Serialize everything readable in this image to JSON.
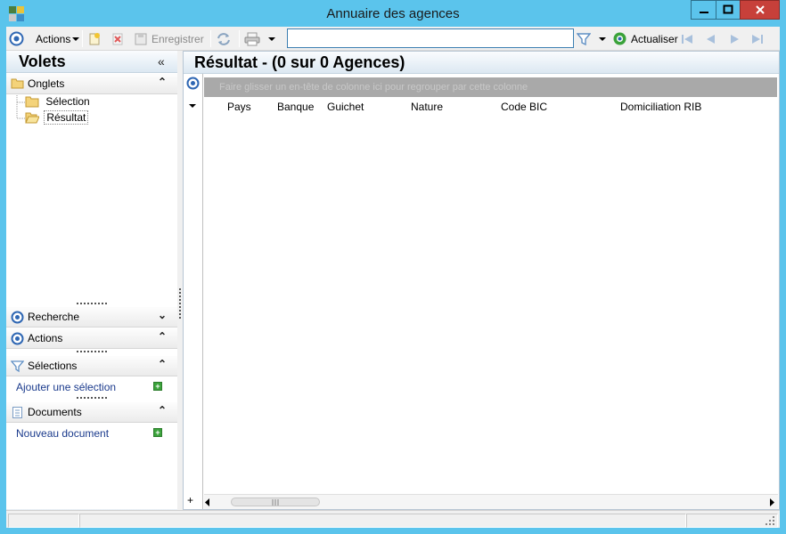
{
  "window": {
    "title": "Annuaire des agences",
    "controls": {
      "minimize": "minimize",
      "maximize": "maximize",
      "close": "close"
    }
  },
  "toolbar": {
    "actions_label": "Actions",
    "save_label": "Enregistrer",
    "search_value": "",
    "refresh_label": "Actualiser"
  },
  "left_panel": {
    "title": "Volets",
    "sections": {
      "onglets": {
        "label": "Onglets",
        "items": [
          "Sélection",
          "Résultat"
        ]
      },
      "recherche": {
        "label": "Recherche"
      },
      "actions": {
        "label": "Actions"
      },
      "selections": {
        "label": "Sélections",
        "link": "Ajouter une sélection"
      },
      "documents": {
        "label": "Documents",
        "link": "Nouveau document"
      }
    }
  },
  "result": {
    "title": "Résultat - (0 sur 0 Agences)",
    "group_hint": "Faire glisser un en-tête de colonne ici pour regrouper par cette colonne",
    "columns": [
      "Pays",
      "Banque",
      "Guichet",
      "Nature",
      "Code BIC",
      "Domiciliation RIB"
    ]
  },
  "colors": {
    "chrome": "#5bc4ec",
    "close_button": "#c7403a",
    "accent_blue": "#2f67b3"
  }
}
